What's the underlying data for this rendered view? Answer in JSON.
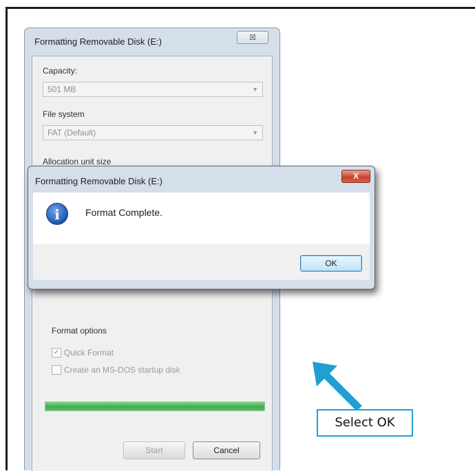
{
  "format_window": {
    "title": "Formatting Removable Disk (E:)",
    "close_glyph": "☒",
    "capacity_label": "Capacity:",
    "capacity_value": "501 MB",
    "filesystem_label": "File system",
    "filesystem_value": "FAT (Default)",
    "allocation_label": "Allocation unit size",
    "format_options_label": "Format options",
    "quick_format_label": "Quick Format",
    "quick_format_checked": true,
    "msdos_label": "Create an MS-DOS startup disk",
    "msdos_checked": false,
    "progress_fraction": 1.0,
    "start_label": "Start",
    "cancel_label": "Cancel"
  },
  "message_box": {
    "title": "Formatting Removable Disk (E:)",
    "close_glyph": "X",
    "icon": "info-icon",
    "message": "Format Complete.",
    "ok_label": "OK"
  },
  "callout": {
    "text": "Select OK",
    "accent_color": "#1ea0d0"
  }
}
